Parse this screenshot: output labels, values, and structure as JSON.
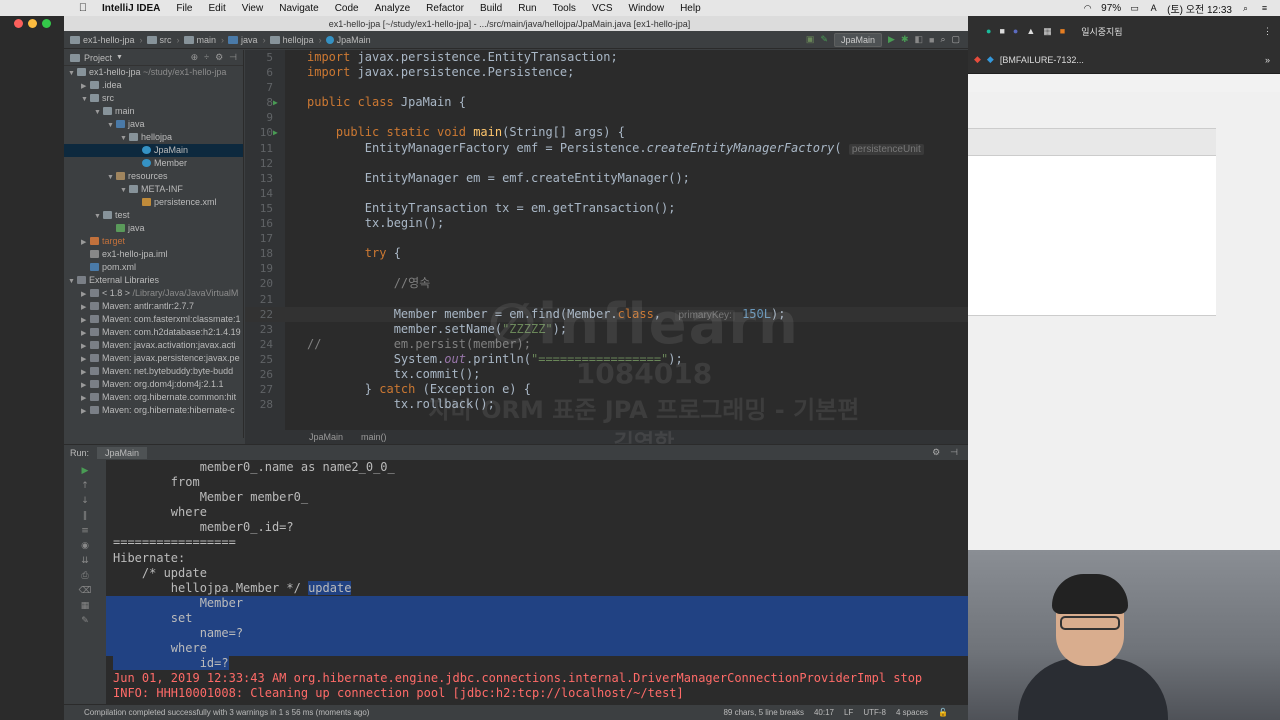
{
  "menubar": {
    "app": "IntelliJ IDEA",
    "items": [
      "File",
      "Edit",
      "View",
      "Navigate",
      "Code",
      "Analyze",
      "Refactor",
      "Build",
      "Run",
      "Tools",
      "VCS",
      "Window",
      "Help"
    ],
    "battery": "97%",
    "clock": "(토) 오전 12:33"
  },
  "window": {
    "title": "ex1-hello-jpa [~/study/ex1-hello-jpa] - .../src/main/java/hellojpa/JpaMain.java [ex1-hello-jpa]"
  },
  "breadcrumbs": [
    "ex1-hello-jpa",
    "src",
    "main",
    "java",
    "hellojpa",
    "JpaMain"
  ],
  "run_config": "JpaMain",
  "project": {
    "header": "Project",
    "tree": [
      {
        "label": "ex1-hello-jpa",
        "extra": "~/study/ex1-hello-jpa",
        "depth": 0,
        "arrow": "▼",
        "icon": "folder"
      },
      {
        "label": ".idea",
        "depth": 1,
        "arrow": "▶",
        "icon": "folder"
      },
      {
        "label": "src",
        "depth": 1,
        "arrow": "▼",
        "icon": "folder"
      },
      {
        "label": "main",
        "depth": 2,
        "arrow": "▼",
        "icon": "folder"
      },
      {
        "label": "java",
        "depth": 3,
        "arrow": "▼",
        "icon": "folder-src"
      },
      {
        "label": "hellojpa",
        "depth": 4,
        "arrow": "▼",
        "icon": "package"
      },
      {
        "label": "JpaMain",
        "depth": 5,
        "arrow": "",
        "icon": "class",
        "selected": true
      },
      {
        "label": "Member",
        "depth": 5,
        "arrow": "",
        "icon": "class"
      },
      {
        "label": "resources",
        "depth": 3,
        "arrow": "▼",
        "icon": "folder-res"
      },
      {
        "label": "META-INF",
        "depth": 4,
        "arrow": "▼",
        "icon": "folder"
      },
      {
        "label": "persistence.xml",
        "depth": 5,
        "arrow": "",
        "icon": "xml"
      },
      {
        "label": "test",
        "depth": 2,
        "arrow": "▼",
        "icon": "folder"
      },
      {
        "label": "java",
        "depth": 3,
        "arrow": "",
        "icon": "folder-test"
      },
      {
        "label": "target",
        "depth": 1,
        "arrow": "▶",
        "icon": "folder-excluded"
      },
      {
        "label": "ex1-hello-jpa.iml",
        "depth": 1,
        "arrow": "",
        "icon": "iml"
      },
      {
        "label": "pom.xml",
        "depth": 1,
        "arrow": "",
        "icon": "maven"
      },
      {
        "label": "External Libraries",
        "depth": 0,
        "arrow": "▼",
        "icon": "lib"
      },
      {
        "label": "< 1.8 >",
        "extra": "/Library/Java/JavaVirtualM",
        "depth": 1,
        "arrow": "▶",
        "icon": "lib"
      },
      {
        "label": "Maven: antlr:antlr:2.7.7",
        "depth": 1,
        "arrow": "▶",
        "icon": "lib"
      },
      {
        "label": "Maven: com.fasterxml:classmate:1",
        "depth": 1,
        "arrow": "▶",
        "icon": "lib"
      },
      {
        "label": "Maven: com.h2database:h2:1.4.19",
        "depth": 1,
        "arrow": "▶",
        "icon": "lib"
      },
      {
        "label": "Maven: javax.activation:javax.acti",
        "depth": 1,
        "arrow": "▶",
        "icon": "lib"
      },
      {
        "label": "Maven: javax.persistence:javax.pe",
        "depth": 1,
        "arrow": "▶",
        "icon": "lib"
      },
      {
        "label": "Maven: net.bytebuddy:byte-budd",
        "depth": 1,
        "arrow": "▶",
        "icon": "lib"
      },
      {
        "label": "Maven: org.dom4j:dom4j:2.1.1",
        "depth": 1,
        "arrow": "▶",
        "icon": "lib"
      },
      {
        "label": "Maven: org.hibernate.common:hit",
        "depth": 1,
        "arrow": "▶",
        "icon": "lib"
      },
      {
        "label": "Maven: org.hibernate:hibernate-c",
        "depth": 1,
        "arrow": "▶",
        "icon": "lib"
      }
    ]
  },
  "editor": {
    "tab": "JpaMain",
    "lines": [
      {
        "n": "5",
        "html": "<span class=\"kw\">import</span> javax.persistence.EntityTransaction;"
      },
      {
        "n": "6",
        "html": "<span class=\"kw\">import</span> javax.persistence.Persistence;"
      },
      {
        "n": "7",
        "html": ""
      },
      {
        "n": "8",
        "html": "<span class=\"kw\">public class</span> JpaMain {",
        "run": true
      },
      {
        "n": "9",
        "html": ""
      },
      {
        "n": "10",
        "html": "    <span class=\"kw\">public static void</span> <span class=\"fn\">main</span>(String[] args) {",
        "run": true
      },
      {
        "n": "11",
        "html": "        EntityManagerFactory emf = Persistence.<span class=\"it\">createEntityManagerFactory</span>( <span class=\"hint\">persistenceUnit</span>"
      },
      {
        "n": "12",
        "html": ""
      },
      {
        "n": "13",
        "html": "        EntityManager em = emf.createEntityManager();"
      },
      {
        "n": "14",
        "html": ""
      },
      {
        "n": "15",
        "html": "        EntityTransaction tx = em.getTransaction();"
      },
      {
        "n": "16",
        "html": "        tx.begin();"
      },
      {
        "n": "17",
        "html": ""
      },
      {
        "n": "18",
        "html": "        <span class=\"kw\">try</span> {"
      },
      {
        "n": "19",
        "html": ""
      },
      {
        "n": "20",
        "html": "            <span class=\"cmt\">//영속</span>"
      },
      {
        "n": "21",
        "html": ""
      },
      {
        "n": "22",
        "html": "            Member member = em.find(Member.<span class=\"kw\">class</span>,  <span class=\"hint\">primaryKey:</span> <span class=\"num\">150L</span>);",
        "current": true
      },
      {
        "n": "23",
        "html": "            member.setName(<span class=\"str\">\"ZZZZZ\"</span>);"
      },
      {
        "n": "24",
        "html": "<span class=\"cmt\">//          em.persist(member);</span>"
      },
      {
        "n": "25",
        "html": "            System.<span class=\"it\" style=\"color:#9876aa\">out</span>.println(<span class=\"str\">\"=================\"</span>);"
      },
      {
        "n": "26",
        "html": "            tx.commit();"
      },
      {
        "n": "27",
        "html": "        } <span class=\"kw\">catch</span> (Exception e) {"
      },
      {
        "n": "28",
        "html": "            tx.rollback();"
      }
    ],
    "status_crumbs": [
      "JpaMain",
      "main()"
    ]
  },
  "watermark": {
    "brand": "∅inflearn",
    "number": "1084018",
    "course": "자바 ORM 표준 JPA 프로그래밍 - 기본편",
    "author": "김영한"
  },
  "run": {
    "label": "Run:",
    "tab": "JpaMain",
    "console": [
      {
        "t": "            member0_.name as name2_0_0_",
        "cls": ""
      },
      {
        "t": "        from",
        "cls": ""
      },
      {
        "t": "            Member member0_",
        "cls": ""
      },
      {
        "t": "        where",
        "cls": ""
      },
      {
        "t": "            member0_.id=?",
        "cls": ""
      },
      {
        "t": "=================",
        "cls": ""
      },
      {
        "t": "Hibernate: ",
        "cls": ""
      },
      {
        "t": "    /* update",
        "cls": ""
      },
      {
        "t": "        hellojpa.Member */ ",
        "sel_tail": "update",
        "cls": ""
      },
      {
        "t": "            Member",
        "cls": "sel"
      },
      {
        "t": "        set",
        "cls": "sel"
      },
      {
        "t": "            name=?",
        "cls": "sel"
      },
      {
        "t": "        where",
        "cls": "sel"
      },
      {
        "t": "            id=?",
        "cls": "sel-part"
      },
      {
        "t": "Jun 01, 2019 12:33:43 AM org.hibernate.engine.jdbc.connections.internal.DriverManagerConnectionProviderImpl stop",
        "cls": "err"
      },
      {
        "t": "INFO: HHH10001008: Cleaning up connection pool [jdbc:h2:tcp://localhost/~/test]",
        "cls": "err"
      }
    ]
  },
  "statusbar": {
    "message": "Compilation completed successfully with 3 warnings in 1 s 56 ms (moments ago)",
    "chars": "89 chars, 5 line breaks",
    "pos": "40:17",
    "lf": "LF",
    "enc": "UTF-8",
    "indent": "4 spaces"
  },
  "browser": {
    "tab": "[BMFAILURE-7132..."
  },
  "colors": {
    "editor_bg": "#2b2b2b",
    "keyword": "#cc7832",
    "string": "#6a8759",
    "selection": "#214283",
    "error": "#ff6b68"
  }
}
